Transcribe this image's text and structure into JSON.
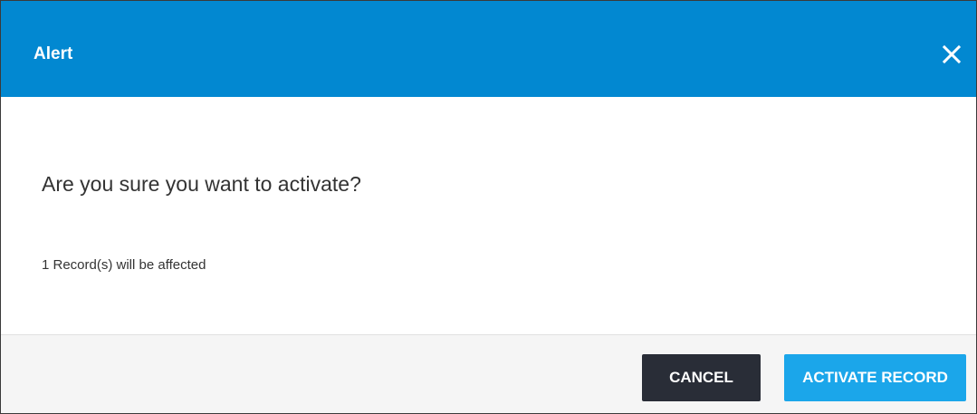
{
  "dialog": {
    "title": "Alert",
    "close_icon": "close-icon",
    "question": "Are you sure you want to activate?",
    "affected_note": "1 Record(s) will be affected",
    "buttons": {
      "cancel_label": "CANCEL",
      "activate_label": "ACTIVATE RECORD"
    }
  },
  "colors": {
    "header_bg": "#0288d1",
    "cancel_bg": "#292d37",
    "activate_bg": "#1ba6ea",
    "footer_bg": "#f5f5f5"
  }
}
